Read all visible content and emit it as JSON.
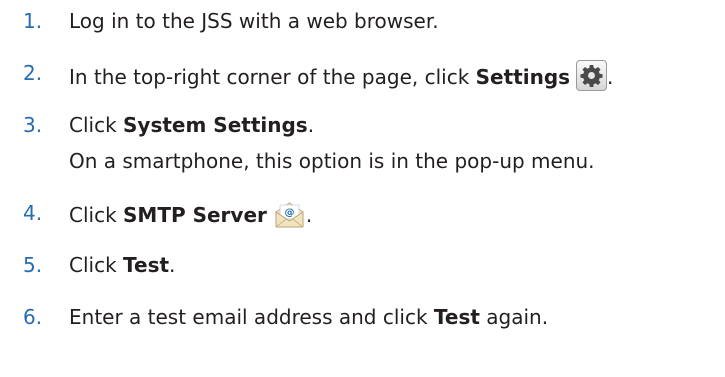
{
  "steps": [
    {
      "number": "1.",
      "text": "Log in to the JSS with a web browser."
    },
    {
      "number": "2.",
      "pre": "In the top-right corner of the page, click ",
      "bold": "Settings",
      "post": ".",
      "icon": "gear-icon"
    },
    {
      "number": "3.",
      "pre": "Click ",
      "bold": "System Settings",
      "post": ".",
      "note": "On a smartphone, this option is in the pop-up menu."
    },
    {
      "number": "4.",
      "pre": "Click ",
      "bold": "SMTP Server",
      "post": ".",
      "icon": "envelope-at-icon"
    },
    {
      "number": "5.",
      "pre": "Click ",
      "bold": "Test",
      "post": "."
    },
    {
      "number": "6.",
      "pre": "Enter a test email address and click ",
      "bold": "Test",
      "post": " again."
    }
  ]
}
